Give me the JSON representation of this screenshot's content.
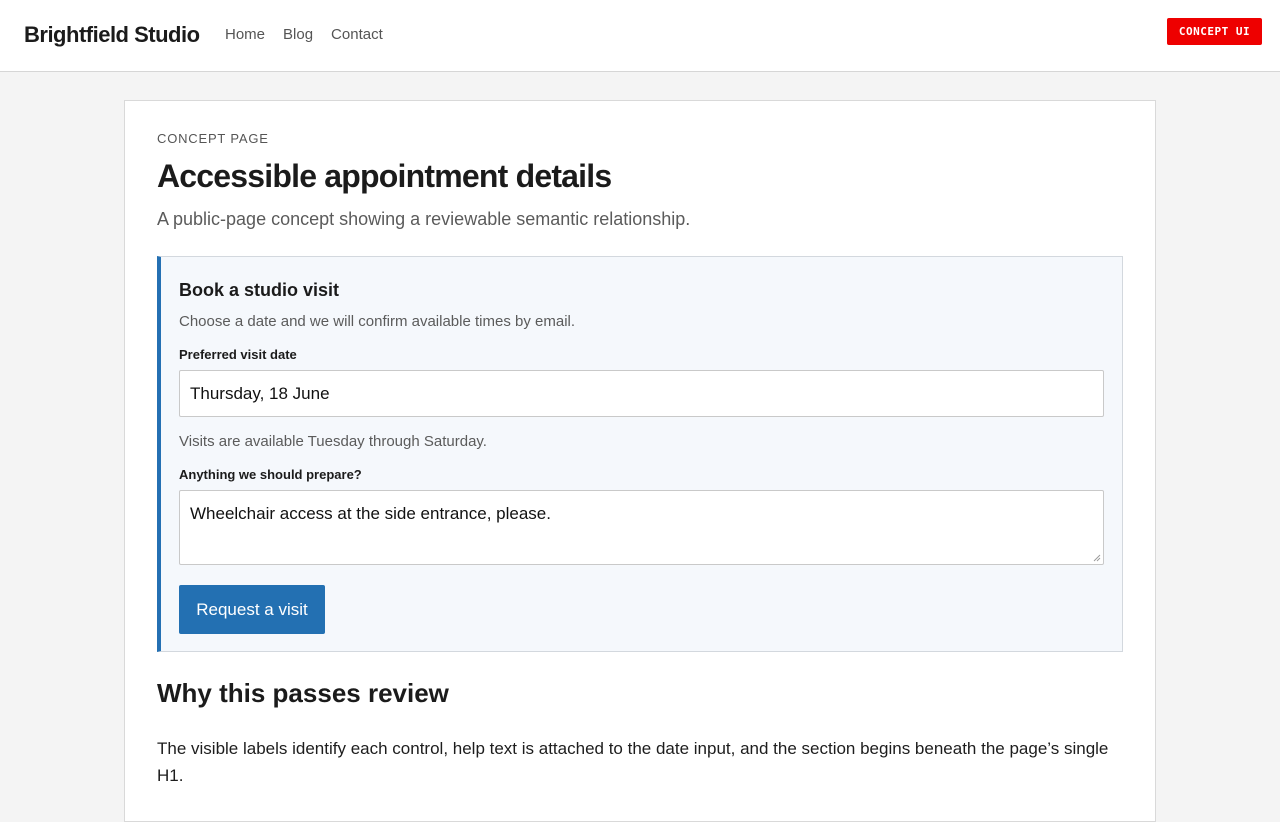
{
  "header": {
    "brand": "Brightfield Studio",
    "nav": [
      "Home",
      "Blog",
      "Contact"
    ],
    "badge": "CONCEPT UI"
  },
  "page": {
    "eyebrow": "CONCEPT PAGE",
    "title": "Accessible appointment details",
    "subtitle": "A public-page concept showing a reviewable semantic relationship."
  },
  "form": {
    "heading": "Book a studio visit",
    "intro": "Choose a date and we will confirm available times by email.",
    "date_label": "Preferred visit date",
    "date_value": "Thursday, 18 June",
    "date_help": "Visits are available Tuesday through Saturday.",
    "prepare_label": "Anything we should prepare?",
    "prepare_value": "Wheelchair access at the side entrance, please.",
    "submit_label": "Request a visit"
  },
  "review": {
    "heading": "Why this passes review",
    "body": "The visible labels identify each control, help text is attached to the date input, and the section begins beneath the page’s single H1."
  },
  "colors": {
    "accent": "#2370b2",
    "badge": "#ee0000",
    "panel_bg": "#f5f8fc"
  }
}
